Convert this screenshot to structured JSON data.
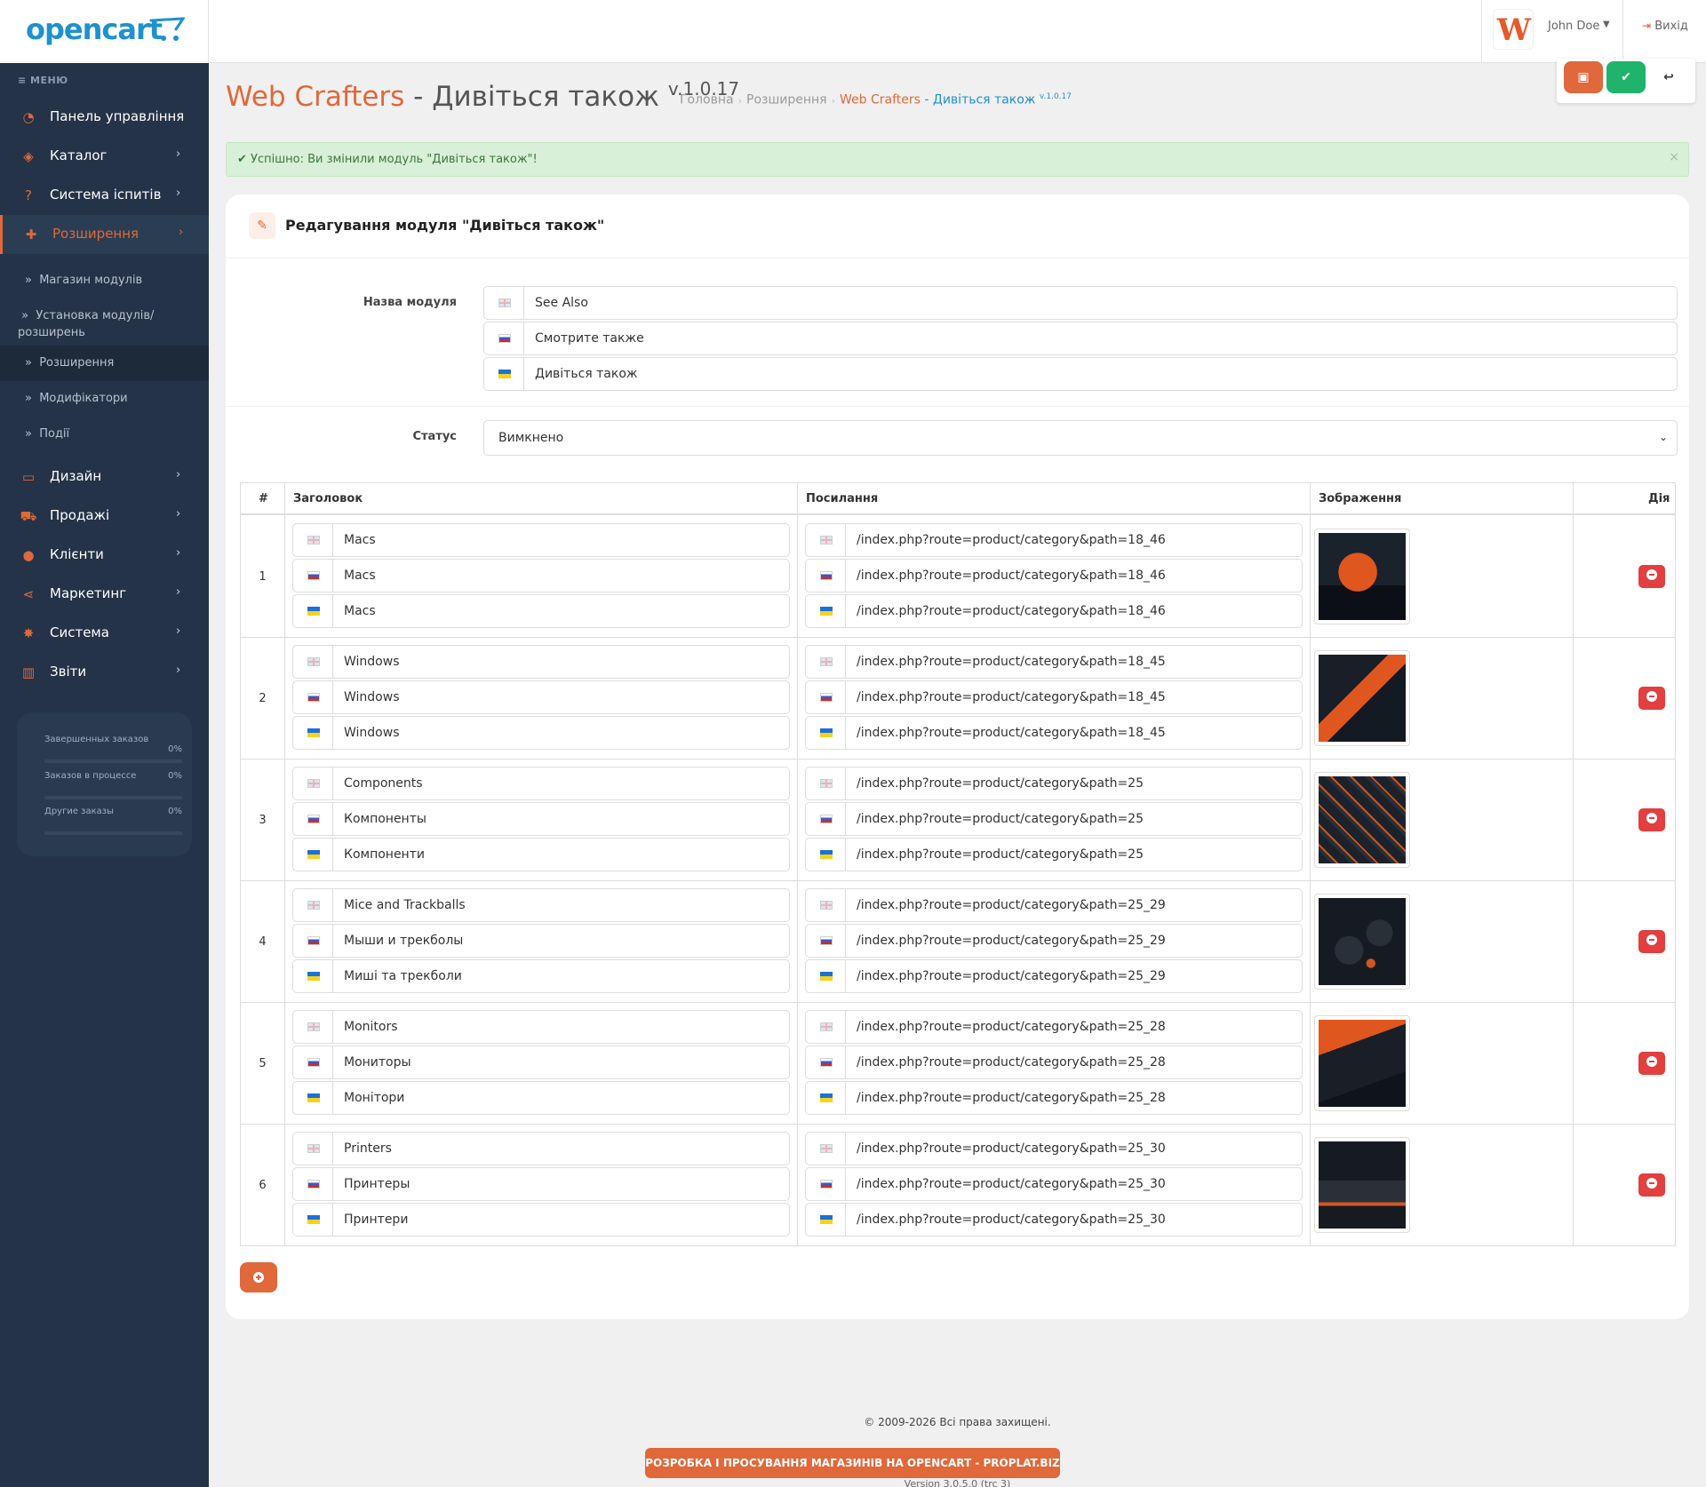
{
  "header": {
    "logo_text": "opencart",
    "user_name": "John Doe",
    "logout_label": "Вихід",
    "avatar_letter": "W"
  },
  "sidebar": {
    "menu_title": "МЕНЮ",
    "items": [
      {
        "label": "Панель управління",
        "icon": "dashboard-icon"
      },
      {
        "label": "Каталог",
        "icon": "tag-icon"
      },
      {
        "label": "Система іспитів",
        "icon": "question-icon"
      },
      {
        "label": "Розширення",
        "icon": "puzzle-icon"
      },
      {
        "label": "Дизайн",
        "icon": "monitor-icon"
      },
      {
        "label": "Продажі",
        "icon": "cart-icon"
      },
      {
        "label": "Клієнти",
        "icon": "user-icon"
      },
      {
        "label": "Маркетинг",
        "icon": "share-icon"
      },
      {
        "label": "Система",
        "icon": "cog-icon"
      },
      {
        "label": "Звіти",
        "icon": "bar-chart-icon"
      }
    ],
    "sub_items": [
      "Магазин модулів",
      "Установка модулів/ розширень",
      "Розширення",
      "Модифікатори",
      "Події"
    ],
    "stats": [
      {
        "label": "Завершенных заказов",
        "value": "0%"
      },
      {
        "label": "Заказов в процессе",
        "value": "0%"
      },
      {
        "label": "Другие заказы",
        "value": "0%"
      }
    ]
  },
  "page": {
    "title_brand": "Web Crafters",
    "title_rest": " - Дивіться також ",
    "title_version": "v.1.0.17",
    "breadcrumb": {
      "home": "Головна",
      "ext": "Розширення",
      "current_brand": "Web Crafters",
      "current_rest": " - Дивіться також",
      "current_version": "v.1.0.17"
    },
    "alert": "Успішно: Ви змінили модуль \"Дивіться також\"!",
    "alert_close": "×"
  },
  "panel": {
    "title": "Редагування модуля \"Дивіться також\"",
    "name_label": "Назва модуля",
    "names": [
      "See Also",
      "Смотрите также",
      "Дивіться також"
    ],
    "status_label": "Статус",
    "status_value": "Вимкнено"
  },
  "table": {
    "headers": {
      "num": "#",
      "title": "Заголовок",
      "link": "Посилання",
      "image": "Зображення",
      "action": "Дія"
    },
    "rows": [
      {
        "num": "1",
        "titles": [
          "Macs",
          "Macs",
          "Macs"
        ],
        "links": [
          "/index.php?route=product/category&path=18_46",
          "/index.php?route=product/category&path=18_46",
          "/index.php?route=product/category&path=18_46"
        ]
      },
      {
        "num": "2",
        "titles": [
          "Windows",
          "Windows",
          "Windows"
        ],
        "links": [
          "/index.php?route=product/category&path=18_45",
          "/index.php?route=product/category&path=18_45",
          "/index.php?route=product/category&path=18_45"
        ]
      },
      {
        "num": "3",
        "titles": [
          "Components",
          "Компоненты",
          "Компоненти"
        ],
        "links": [
          "/index.php?route=product/category&path=25",
          "/index.php?route=product/category&path=25",
          "/index.php?route=product/category&path=25"
        ]
      },
      {
        "num": "4",
        "titles": [
          "Mice and Trackballs",
          "Мыши и трекболы",
          "Миші та трекболи"
        ],
        "links": [
          "/index.php?route=product/category&path=25_29",
          "/index.php?route=product/category&path=25_29",
          "/index.php?route=product/category&path=25_29"
        ]
      },
      {
        "num": "5",
        "titles": [
          "Monitors",
          "Мониторы",
          "Монітори"
        ],
        "links": [
          "/index.php?route=product/category&path=25_28",
          "/index.php?route=product/category&path=25_28",
          "/index.php?route=product/category&path=25_28"
        ]
      },
      {
        "num": "6",
        "titles": [
          "Printers",
          "Принтеры",
          "Принтери"
        ],
        "links": [
          "/index.php?route=product/category&path=25_30",
          "/index.php?route=product/category&path=25_30",
          "/index.php?route=product/category&path=25_30"
        ]
      }
    ]
  },
  "footer": {
    "copyright": "© 2009-2026 Всі права захищені.",
    "promo": "РОЗРОБКА І ПРОСУВАННЯ МАГАЗИНІВ НА OPENCART - PROPLAT.BIZ",
    "version": "Version 3.0.5.0 (trc 3)"
  },
  "colors": {
    "accent": "#e0683a",
    "sidebar_bg": "#243347",
    "success": "#1fb36b",
    "danger": "#e23f3f",
    "link": "#1e91cf"
  }
}
